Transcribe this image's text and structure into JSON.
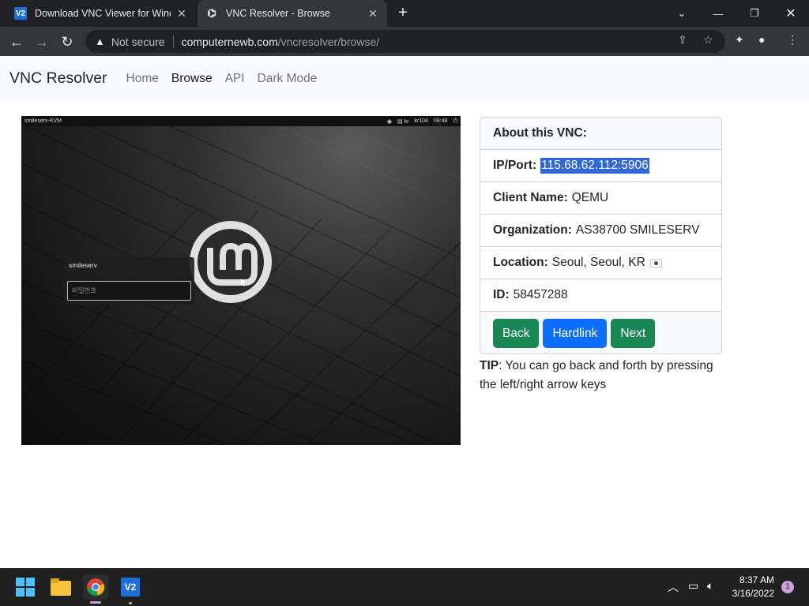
{
  "browser": {
    "tabs": [
      {
        "title": "Download VNC Viewer for Windo",
        "icon": "vnc-viewer-icon",
        "active": false
      },
      {
        "title": "VNC Resolver - Browse",
        "icon": "vnc-resolver-icon",
        "active": true
      }
    ],
    "favicon_text": "V2",
    "security_label": "Not secure",
    "url_host": "computernewb.com",
    "url_path": "/vncresolver/browse/"
  },
  "site": {
    "brand": "VNC Resolver",
    "nav": [
      "Home",
      "Browse",
      "API",
      "Dark Mode"
    ],
    "active_nav": "Browse"
  },
  "screenshot": {
    "hostname": "smileserv-KVM",
    "tray_layout": "kr",
    "tray_lang": "kr104",
    "tray_time": "08:48",
    "login_user": "smileserv",
    "password_placeholder": "비밀번호"
  },
  "info": {
    "header": "About this VNC:",
    "ip_label": "IP/Port:",
    "ip_value": "115.68.62.112:5906",
    "client_label": "Client Name:",
    "client_value": "QEMU",
    "org_label": "Organization:",
    "org_value": "AS38700 SMILESERV",
    "location_label": "Location:",
    "location_value": "Seoul, Seoul, KR",
    "id_label": "ID:",
    "id_value": "58457288",
    "buttons": {
      "back": "Back",
      "hardlink": "Hardlink",
      "next": "Next"
    },
    "colors": {
      "back": "#198754",
      "hardlink": "#0d6efd",
      "next": "#198754",
      "selection": "#3166d6"
    }
  },
  "tip": {
    "label": "TIP",
    "text": ": You can go back and forth by pressing the left/right arrow keys"
  },
  "taskbar": {
    "time": "8:37 AM",
    "date": "3/16/2022",
    "notification_count": "1",
    "favicon_text": "V2"
  }
}
